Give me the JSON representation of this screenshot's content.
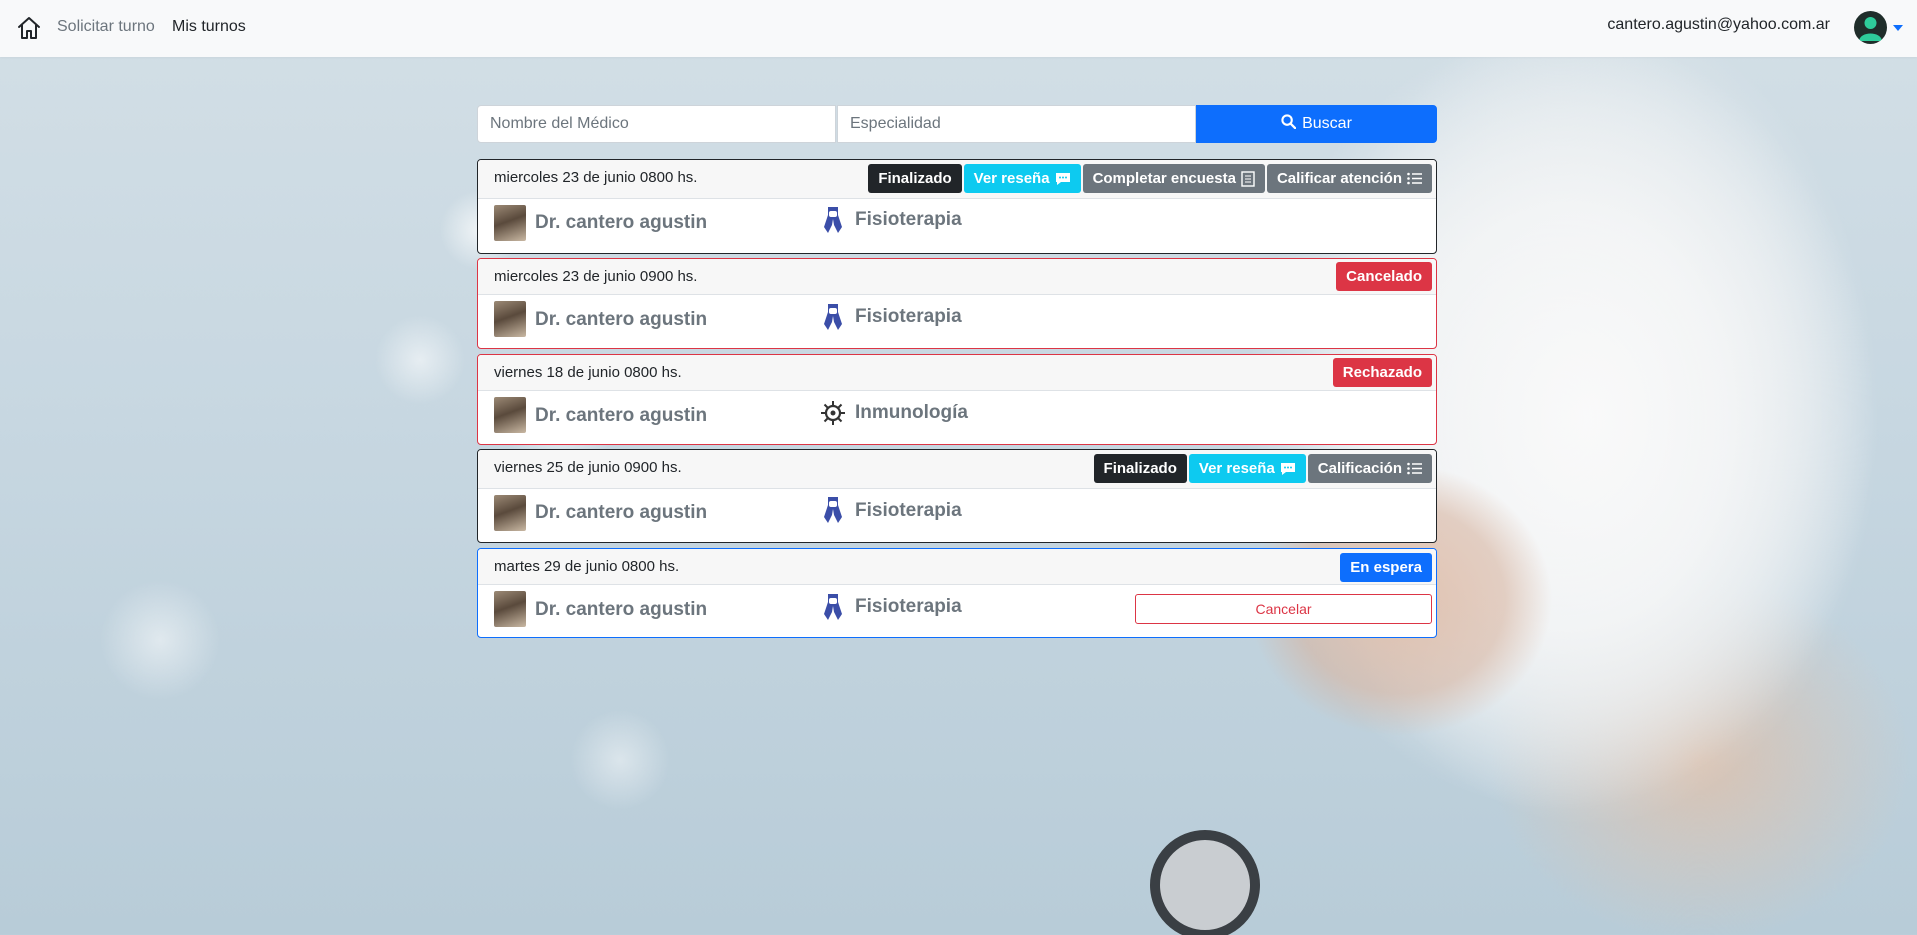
{
  "navbar": {
    "links": [
      "Solicitar turno",
      "Mis turnos"
    ],
    "user_email": "cantero.agustin@yahoo.com.ar",
    "icons": {
      "home": "home-icon",
      "avatar": "user-avatar-icon",
      "caret": "caret-down-icon"
    }
  },
  "search": {
    "doctor_placeholder": "Nombre del Médico",
    "specialty_placeholder": "Especialidad",
    "button_label": "Buscar",
    "button_icon": "search-icon"
  },
  "appointments": [
    {
      "date": "miercoles 23 de junio 0800 hs.",
      "status": "Finalizado",
      "actions": [
        "Ver reseña",
        "Completar encuesta",
        "Calificar atención"
      ],
      "doctor": "Dr. cantero agustin",
      "specialty": "Fisioterapia",
      "specialty_icon": "physio-icon"
    },
    {
      "date": "miercoles 23 de junio 0900 hs.",
      "status": "Cancelado",
      "doctor": "Dr. cantero agustin",
      "specialty": "Fisioterapia",
      "specialty_icon": "physio-icon"
    },
    {
      "date": "viernes 18 de junio 0800 hs.",
      "status": "Rechazado",
      "doctor": "Dr. cantero agustin",
      "specialty": "Inmunología",
      "specialty_icon": "virus-icon"
    },
    {
      "date": "viernes 25 de junio 0900 hs.",
      "status": "Finalizado",
      "actions": [
        "Ver reseña",
        "Calificación"
      ],
      "doctor": "Dr. cantero agustin",
      "specialty": "Fisioterapia",
      "specialty_icon": "physio-icon"
    },
    {
      "date": "martes 29 de junio 0800 hs.",
      "status": "En espera",
      "doctor": "Dr. cantero agustin",
      "specialty": "Fisioterapia",
      "specialty_icon": "physio-icon",
      "cancel_label": "Cancelar"
    }
  ],
  "colors": {
    "primary": "#0d6efd",
    "info": "#0dcaf0",
    "danger": "#dc3545",
    "dark": "#212529",
    "secondary": "#6c757d"
  }
}
